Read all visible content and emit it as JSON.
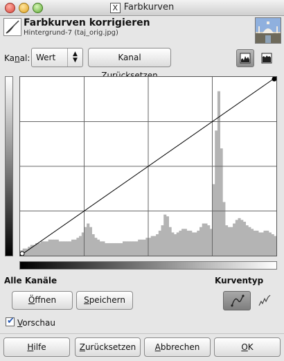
{
  "window": {
    "title": "Farbkurven"
  },
  "header": {
    "title": "Farbkurven korrigieren",
    "subtitle": "Hintergrund-7 (taj_orig.jpg)"
  },
  "channel": {
    "label_pre": "Ka",
    "label_mnemonic": "n",
    "label_post": "al:",
    "value": "Wert",
    "reset_pre": "Kanal ",
    "reset_mnemonic": "Z",
    "reset_post": "urücksetzen"
  },
  "sections": {
    "all_channels": "Alle Kanäle",
    "curve_type": "Kurventyp"
  },
  "buttons": {
    "open_mnemonic": "Ö",
    "open_rest": "ffnen",
    "save_mnemonic": "S",
    "save_rest": "peichern",
    "help_mnemonic": "H",
    "help_rest": "ilfe",
    "reset_mnemonic": "Z",
    "reset_rest": "urücksetzen",
    "cancel_mnemonic": "A",
    "cancel_rest": "bbrechen",
    "ok_mnemonic": "O",
    "ok_rest": "K"
  },
  "preview": {
    "mnemonic": "V",
    "rest": "orschau",
    "checked": true
  },
  "curve": {
    "points": [
      [
        0,
        0
      ],
      [
        255,
        255
      ]
    ],
    "type": "smooth"
  },
  "histogram": {
    "color": "#b4b4b4",
    "bins": [
      3,
      4,
      4,
      5,
      6,
      6,
      7,
      7,
      8,
      8,
      8,
      9,
      9,
      9,
      9,
      8,
      8,
      8,
      8,
      8,
      9,
      9,
      10,
      11,
      13,
      16,
      18,
      16,
      12,
      10,
      9,
      8,
      8,
      7,
      7,
      7,
      7,
      7,
      7,
      7,
      8,
      8,
      8,
      8,
      8,
      8,
      9,
      9,
      9,
      10,
      10,
      11,
      11,
      12,
      14,
      17,
      23,
      22,
      16,
      13,
      12,
      13,
      14,
      15,
      15,
      14,
      14,
      13,
      13,
      14,
      16,
      18,
      18,
      17,
      15,
      40,
      70,
      92,
      60,
      30,
      17,
      16,
      16,
      18,
      20,
      21,
      20,
      19,
      17,
      16,
      15,
      14,
      14,
      13,
      13,
      14,
      14,
      13,
      12,
      11
    ]
  },
  "colors": {
    "window_bg": "#e6e6e6",
    "grid": "#666666",
    "curve": "#000000"
  }
}
